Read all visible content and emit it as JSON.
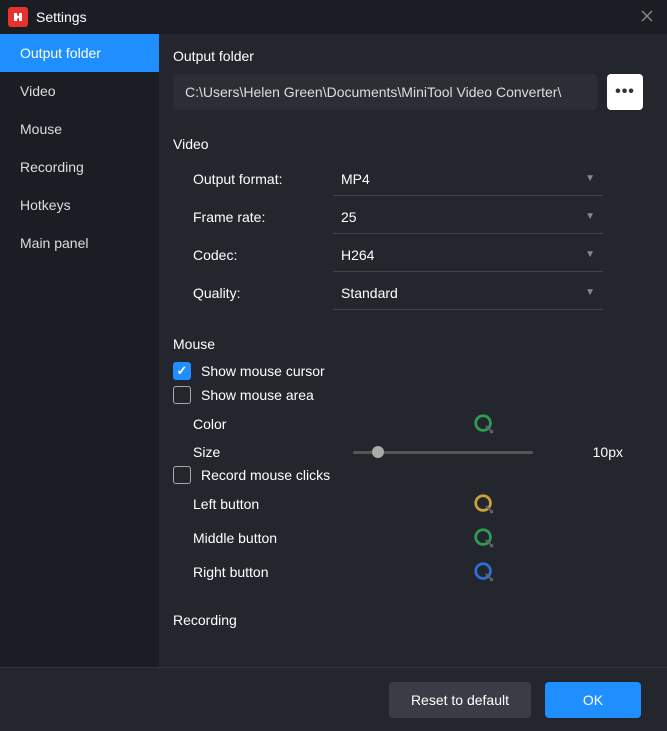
{
  "window": {
    "title": "Settings"
  },
  "sidebar": {
    "items": [
      {
        "label": "Output folder",
        "active": true
      },
      {
        "label": "Video"
      },
      {
        "label": "Mouse"
      },
      {
        "label": "Recording"
      },
      {
        "label": "Hotkeys"
      },
      {
        "label": "Main panel"
      }
    ]
  },
  "sections": {
    "output_folder": {
      "title": "Output folder",
      "path": "C:\\Users\\Helen Green\\Documents\\MiniTool Video Converter\\"
    },
    "video": {
      "title": "Video",
      "output_format_label": "Output format:",
      "output_format": "MP4",
      "frame_rate_label": "Frame rate:",
      "frame_rate": "25",
      "codec_label": "Codec:",
      "codec": "H264",
      "quality_label": "Quality:",
      "quality": "Standard"
    },
    "mouse": {
      "title": "Mouse",
      "show_cursor_label": "Show mouse cursor",
      "show_cursor_checked": true,
      "show_area_label": "Show mouse area",
      "show_area_checked": false,
      "color_label": "Color",
      "area_color": "#2e9d54",
      "size_label": "Size",
      "size_value": "10px",
      "record_clicks_label": "Record mouse clicks",
      "record_clicks_checked": false,
      "left_button_label": "Left button",
      "left_color": "#c9a23a",
      "middle_button_label": "Middle button",
      "middle_color": "#2e9d54",
      "right_button_label": "Right button",
      "right_color": "#2d6fd6"
    },
    "recording": {
      "title": "Recording"
    }
  },
  "footer": {
    "reset": "Reset to default",
    "ok": "OK"
  }
}
